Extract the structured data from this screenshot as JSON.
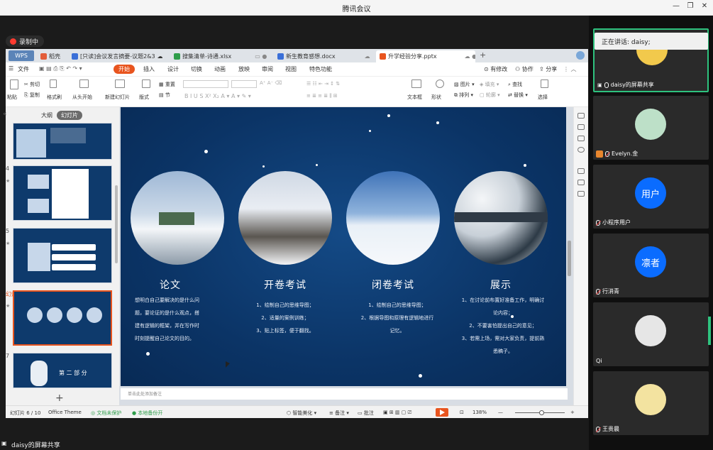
{
  "meeting": {
    "title": "腾讯会议",
    "recording": "录制中",
    "speaking": "正在讲话: daisy;",
    "screen_share_label": "daisy的屏幕共享"
  },
  "wps": {
    "tabs": [
      {
        "label": "WPS"
      },
      {
        "label": "稻壳"
      },
      {
        "label": "[只读]会议发言摘要-议题2&3"
      },
      {
        "label": "搜集清单-诗通.xlsx"
      },
      {
        "label": "新生教育感想.docx"
      },
      {
        "label": "升学经验分享.pptx"
      }
    ],
    "menu": {
      "file": "文件",
      "items": [
        "开始",
        "插入",
        "设计",
        "切换",
        "动画",
        "放映",
        "审阅",
        "视图",
        "特色功能"
      ],
      "changes": "有修改",
      "collab": "协作",
      "share": "分享"
    },
    "ribbon": {
      "paste": "粘贴",
      "cut": "剪切",
      "copy": "复制",
      "format_painter": "格式刷",
      "from_start": "从头开始",
      "new_slide": "新建幻灯片",
      "layout": "版式",
      "reset": "重置",
      "section": "节",
      "textbox": "文本框",
      "shape": "形状",
      "picture": "图片",
      "arrange": "排列",
      "fill": "填充",
      "outline": "轮廓",
      "find": "查找",
      "replace": "替换",
      "select": "选择"
    },
    "left_panel": {
      "outline": "大纲",
      "slides": "幻灯片",
      "numbers": [
        "4",
        "5",
        "6",
        "7"
      ]
    },
    "slide": {
      "columns": [
        {
          "title": "论文",
          "lines": [
            "想明白自己要解决的是什么问",
            "题，要论证的是什么观点，搭",
            "建有逻辑的框架，并在写作时",
            "时刻提醒自己论文的目的。"
          ]
        },
        {
          "title": "开卷考试",
          "lines": [
            "1、绘制自己的思维导图；",
            "2、适量的案例训练；",
            "3、贴上标签，便于翻找。"
          ]
        },
        {
          "title": "闭卷考试",
          "lines": [
            "1、绘制自己的思维导图；",
            "2、根据导图和原理有逻辑地进行",
            "记忆。"
          ]
        },
        {
          "title": "展示",
          "lines": [
            "1、在讨论前布置好准备工作，明确讨",
            "论内容；",
            "2、不要害怕提出自己的意见；",
            "3、若需上场，需对大家负责，提前熟",
            "悉稿子。"
          ]
        }
      ],
      "thumb7_text": "第 二 部 分"
    },
    "notes_placeholder": "单击此处添加备注",
    "status": {
      "slide_count": "幻灯片 6 / 10",
      "theme": "Office Theme",
      "protect": "文档未保护",
      "backup": "本地备份开",
      "beautify": "智能美化",
      "notes": "备注",
      "comments": "批注",
      "zoom": "138%"
    }
  },
  "participants": [
    {
      "name": "daisy的屏幕共享",
      "kind": "photo",
      "color": "#f2c94c"
    },
    {
      "name": "Evelyn.金",
      "kind": "photo",
      "color": "#bde0c8"
    },
    {
      "name": "小程序用户",
      "kind": "text",
      "avatar_text": "用户"
    },
    {
      "name": "行消青",
      "kind": "text",
      "avatar_text": "凛者"
    },
    {
      "name": "Qi",
      "kind": "photo",
      "color": "#e6e6e6"
    },
    {
      "name": "王贵晨",
      "kind": "photo",
      "color": "#f3e3a0"
    }
  ],
  "colors": {
    "accent": "#e8541e",
    "slide_bg": "#0b3466",
    "avatar_blue": "#0a6cff",
    "speaking_border": "#2ec27e"
  }
}
